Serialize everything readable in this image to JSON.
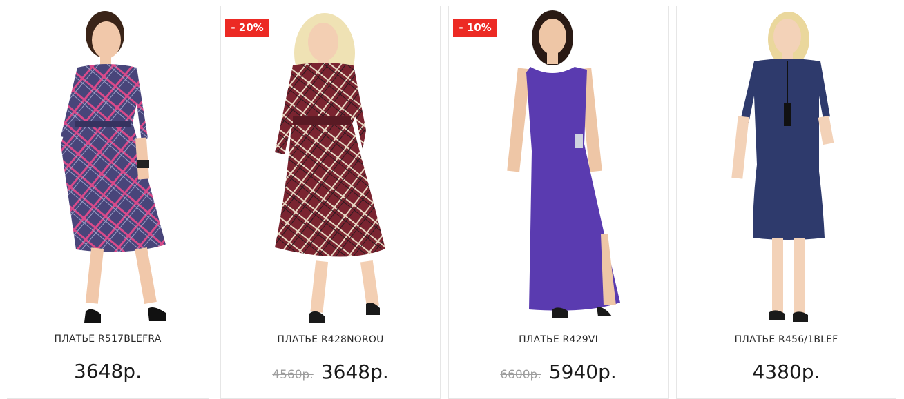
{
  "products": [
    {
      "name": "ПЛАТЬЕ R517BLEFRA",
      "price": "3648р.",
      "old_price": "",
      "discount": "",
      "image_icon": "dress-plaid-purple-photo",
      "colors": {
        "dress": "#4b4a78",
        "check": "#d84a8a"
      }
    },
    {
      "name": "ПЛАТЬЕ R428NOROU",
      "price": "3648р.",
      "old_price": "4560р.",
      "discount": "- 20%",
      "image_icon": "dress-plaid-red-photo",
      "colors": {
        "dress": "#7a2430",
        "check": "#e7d9c4"
      }
    },
    {
      "name": "ПЛАТЬЕ R429VI",
      "price": "5940р.",
      "old_price": "6600р.",
      "discount": "- 10%",
      "image_icon": "dress-violet-maxi-photo",
      "colors": {
        "dress": "#5a3bb0"
      }
    },
    {
      "name": "ПЛАТЬЕ R456/1BLEF",
      "price": "4380р.",
      "old_price": "",
      "discount": "",
      "image_icon": "dress-navy-midi-photo",
      "colors": {
        "dress": "#2e3a6c"
      }
    }
  ],
  "theme": {
    "badge": "#ec2a24",
    "border": "#e6e6e6",
    "old_price": "#9d9d9d"
  }
}
